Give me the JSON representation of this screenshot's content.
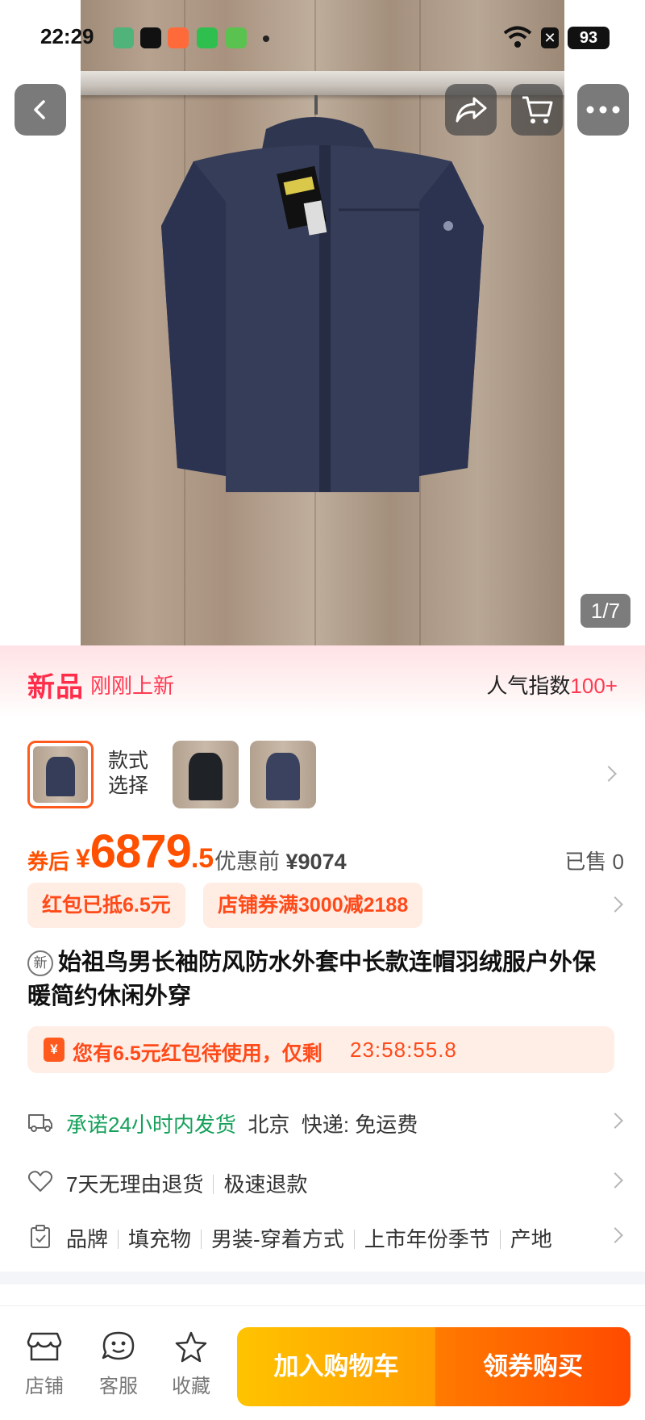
{
  "status_bar": {
    "time": "22:29",
    "battery": "93",
    "x_badge": "✕"
  },
  "nav": {
    "back_icon": "chevron-left-icon",
    "share_icon": "share-icon",
    "cart_icon": "cart-icon",
    "more_icon": "more-icon"
  },
  "gallery": {
    "counter": "1/7"
  },
  "new_banner": {
    "title": "新品",
    "subtitle": "刚刚上新",
    "popularity_label": "人气指数",
    "popularity_value": "100+"
  },
  "style_select": {
    "label_line1": "款式",
    "label_line2": "选择"
  },
  "price": {
    "after_coupon_label": "券后",
    "currency": "¥",
    "integer": "6879",
    "decimal": ".5",
    "before_label": "优惠前",
    "before_value": "¥9074",
    "sold": "已售 0"
  },
  "coupons": [
    {
      "text": "红包已抵6.5元"
    },
    {
      "text": "店铺券满3000减2188"
    }
  ],
  "product": {
    "new_badge": "新",
    "title": "始祖鸟男长袖防风防水外套中长款连帽羽绒服户外保暖简约休闲外穿"
  },
  "red_packet": {
    "icon": "¥",
    "text": "您有6.5元红包待使用，仅剩",
    "timer": "23:58:55.8"
  },
  "shipping": {
    "promise": "承诺24小时内发货",
    "origin": "北京",
    "express": "快递: 免运费"
  },
  "returns": {
    "policy": "7天无理由退货",
    "refund": "极速退款"
  },
  "params": {
    "items": [
      "品牌",
      "填充物",
      "男装-穿着方式",
      "上市年份季节",
      "产地"
    ]
  },
  "bottom_bar": {
    "store": "店铺",
    "service": "客服",
    "favorite": "收藏",
    "add_cart": "加入购物车",
    "buy": "领券购买"
  },
  "colors": {
    "accent_orange": "#ff5000",
    "new_red": "#ff2c4a",
    "green": "#16a15a"
  }
}
